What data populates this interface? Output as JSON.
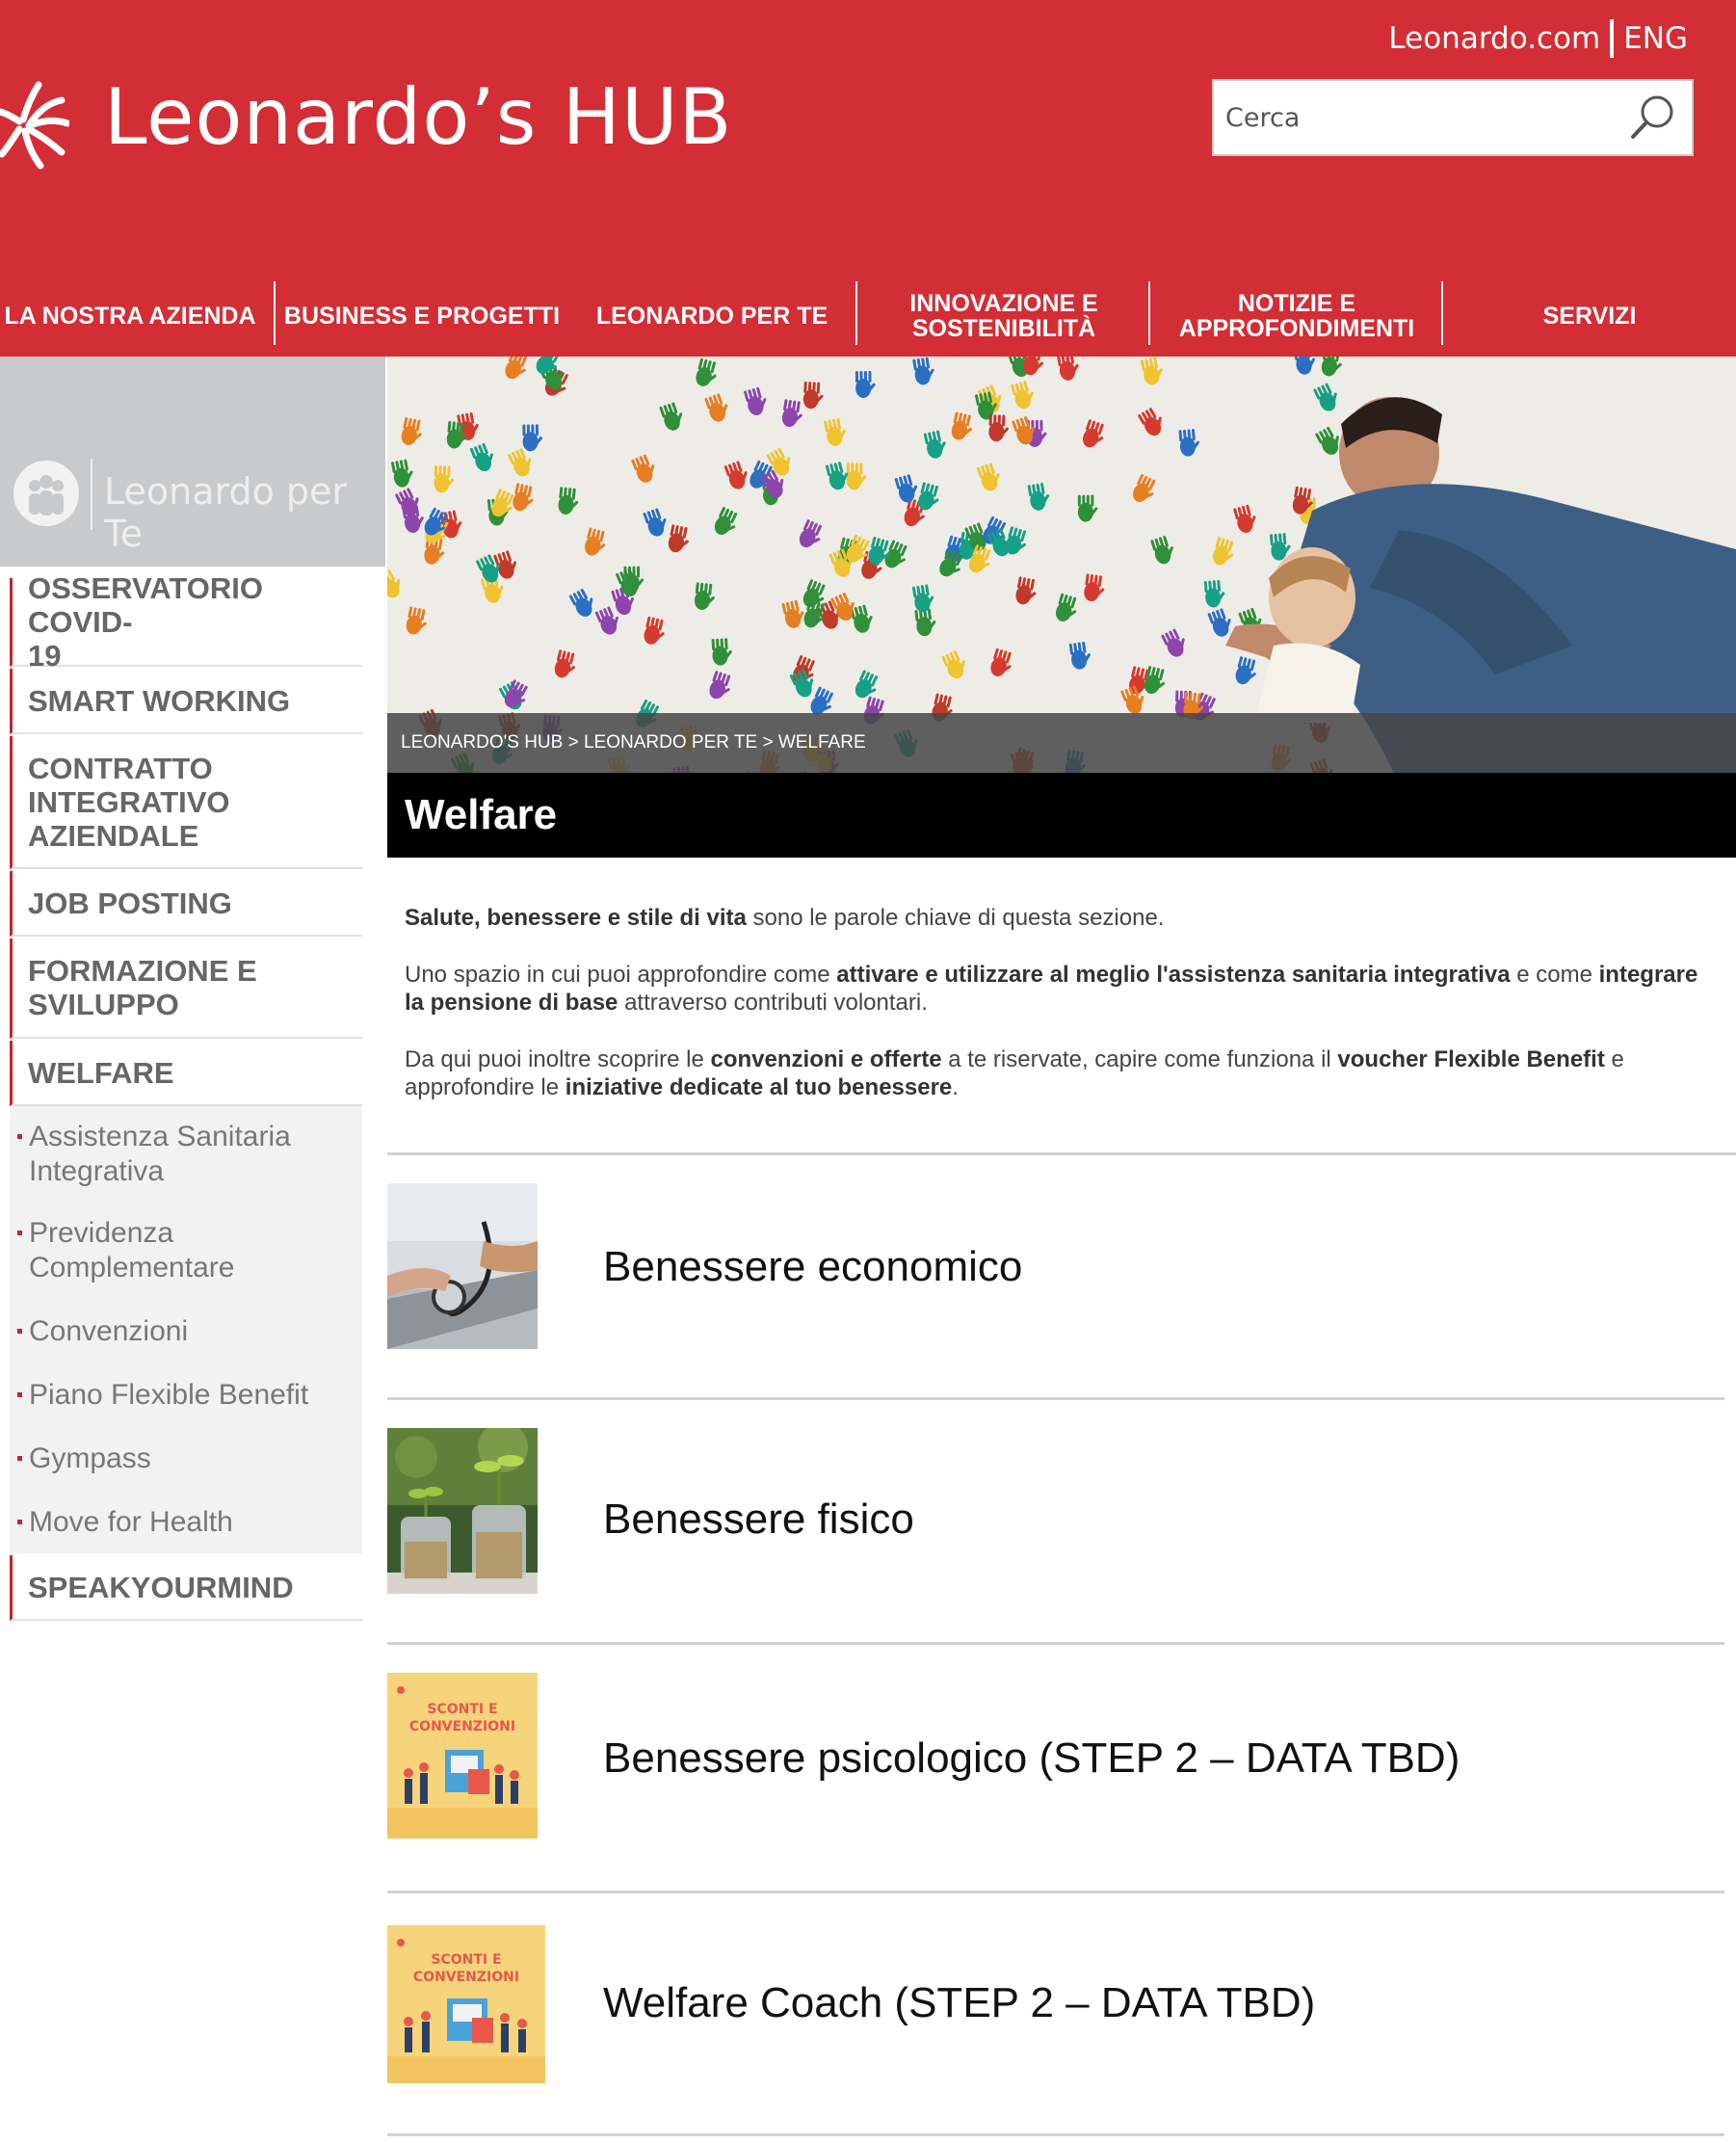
{
  "header": {
    "site_title": "Leonardo’s HUB",
    "top_link_site": "Leonardo.com",
    "top_link_lang": "ENG",
    "search_placeholder": "Cerca",
    "brand_color": "#d32d35"
  },
  "nav": {
    "items": [
      {
        "label": "LA NOSTRA AZIENDA"
      },
      {
        "label": "BUSINESS E PROGETTI"
      },
      {
        "label": "LEONARDO PER TE"
      },
      {
        "label_line1": "INNOVAZIONE E",
        "label_line2": "SOSTENIBILITÀ"
      },
      {
        "label_line1": "NOTIZIE E",
        "label_line2": "APPROFONDIMENTI"
      },
      {
        "label": "SERVIZI"
      }
    ]
  },
  "sidebar": {
    "section_title": "Leonardo per Te",
    "items": [
      {
        "label_line1": "OSSERVATORIO COVID-",
        "label_line2": "19"
      },
      {
        "label": "SMART WORKING"
      },
      {
        "label_line1": "CONTRATTO",
        "label_line2": "INTEGRATIVO",
        "label_line3": "AZIENDALE"
      },
      {
        "label": "JOB POSTING"
      },
      {
        "label_line1": "FORMAZIONE E",
        "label_line2": "SVILUPPO"
      },
      {
        "label": "WELFARE"
      },
      {
        "label": "SPEAKYOURMIND"
      }
    ],
    "subitems": [
      {
        "label_line1": "Assistenza Sanitaria",
        "label_line2": "Integrativa"
      },
      {
        "label_line1": "Previdenza",
        "label_line2": "Complementare"
      },
      {
        "label": "Convenzioni"
      },
      {
        "label": "Piano Flexible Benefit"
      },
      {
        "label": "Gympass"
      },
      {
        "label": "Move for Health"
      }
    ]
  },
  "page": {
    "breadcrumb": "LEONARDO'S HUB > LEONARDO PER TE > WELFARE",
    "title": "Welfare",
    "intro": {
      "p1_bold": "Salute, benessere e stile di vita",
      "p1_rest": " sono le parole chiave di questa sezione.",
      "p2_a": "Uno spazio in cui puoi approfondire come ",
      "p2_b": "attivare e utilizzare al meglio l'assistenza sanitaria integrativa",
      "p2_c": " e come ",
      "p2_d": "integrare la pensione di base",
      "p2_e": " attraverso contributi volontari.",
      "p3_a": "Da qui puoi inoltre scoprire le ",
      "p3_b": "convenzioni e offerte",
      "p3_c": " a te riservate, capire come funziona il ",
      "p3_d": "voucher Flexible Benefit",
      "p3_e": " e approfondire le ",
      "p3_f": "iniziative dedicate al tuo benessere",
      "p3_g": "."
    }
  },
  "cards": [
    {
      "title": "Benessere economico",
      "image": "stethoscope-laptop-photo"
    },
    {
      "title": "Benessere fisico",
      "image": "coin-jars-plants-photo"
    },
    {
      "title": "Benessere psicologico (STEP 2 – DATA TBD)",
      "image": "sconti-convenzioni-illustration",
      "image_text_line1": "SCONTI E",
      "image_text_line2": "CONVENZIONI"
    },
    {
      "title": "Welfare Coach (STEP 2 – DATA TBD)",
      "image": "sconti-convenzioni-illustration",
      "image_text_line1": "SCONTI E",
      "image_text_line2": "CONVENZIONI"
    }
  ]
}
